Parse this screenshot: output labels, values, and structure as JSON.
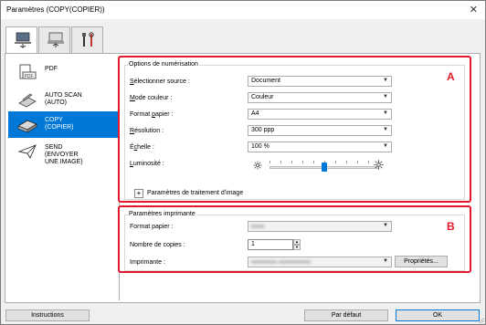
{
  "window": {
    "title": "Paramètres (COPY(COPIER))",
    "close_glyph": "✕"
  },
  "tabs": [
    {
      "name": "scan-from-computer",
      "icon": "computer-scan-icon"
    },
    {
      "name": "scan-from-operation-panel",
      "icon": "operation-panel-icon"
    },
    {
      "name": "general-settings",
      "icon": "tools-icon"
    }
  ],
  "sidebar": {
    "items": [
      {
        "label": "PDF",
        "icon": "pdf-icon"
      },
      {
        "label": "AUTO SCAN\n(AUTO)",
        "icon": "auto-scan-icon"
      },
      {
        "label": "COPY\n(COPIER)",
        "icon": "copy-icon",
        "selected": true
      },
      {
        "label": "SEND\n(ENVOYER\nUNE IMAGE)",
        "icon": "send-icon"
      }
    ]
  },
  "scan_options": {
    "legend": "Options de numérisation",
    "marker": "A",
    "source_label_u": "S",
    "source_label_rest": "électionner source :",
    "source_value": "Document",
    "color_label_u": "M",
    "color_label_rest": "ode couleur :",
    "color_value": "Couleur",
    "paper_label_pre": "Format ",
    "paper_label_u": "p",
    "paper_label_rest": "apier :",
    "paper_value": "A4",
    "res_label_u": "R",
    "res_label_rest": "ésolution :",
    "res_value": "300 ppp",
    "scale_label_pre": "É",
    "scale_label_u": "c",
    "scale_label_rest": "helle :",
    "scale_value": "100 %",
    "brightness_label_pre": "",
    "brightness_label_u": "L",
    "brightness_label_rest": "uminosité :",
    "brightness_level": 0.5,
    "image_processing_plus": "+",
    "image_processing_label": "Paramètres de traitement d'image"
  },
  "printer_settings": {
    "legend": "Paramètres imprimante",
    "marker": "B",
    "paper_label": "Format papier :",
    "copies_label": "Nombre de copies :",
    "copies_value": "1",
    "printer_label": "Imprimante :",
    "properties_button": "Propriétés..."
  },
  "footer": {
    "instructions": "Instructions",
    "defaults": "Par défaut",
    "ok": "OK"
  },
  "colors": {
    "accent": "#0078d7",
    "highlight_border": "#e3182d"
  }
}
